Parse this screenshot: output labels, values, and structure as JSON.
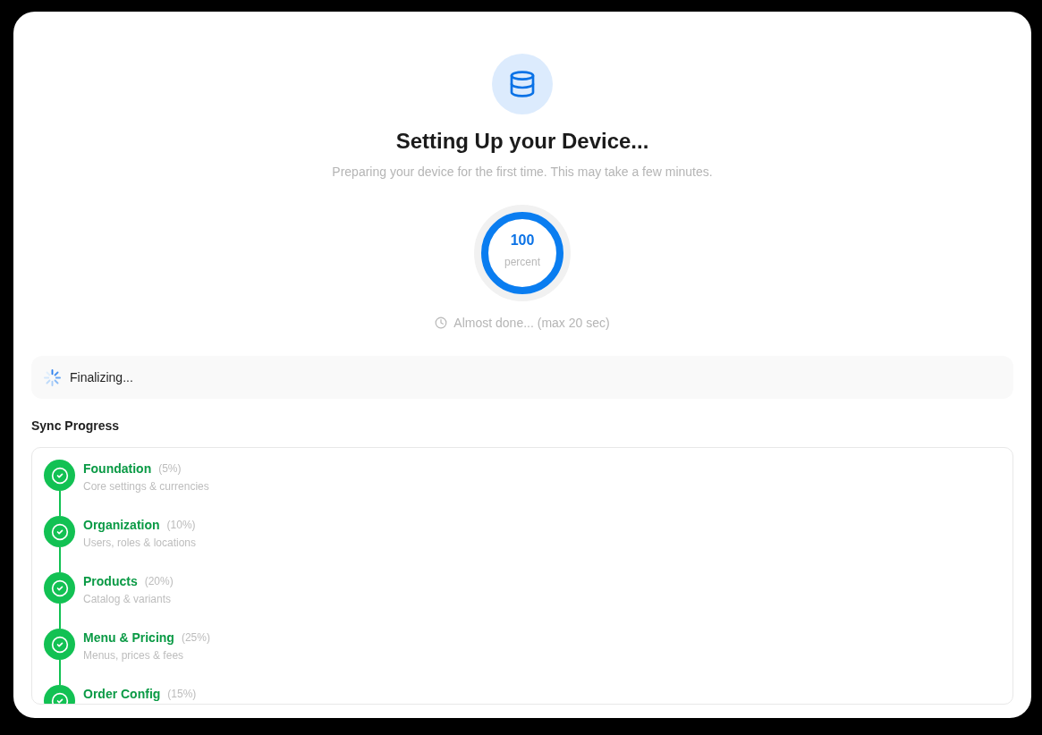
{
  "header": {
    "title": "Setting Up your Device...",
    "subtitle": "Preparing your device for the first time. This may take a few minutes."
  },
  "progress": {
    "level": 1,
    "value": "100",
    "unit": "percent",
    "eta": "Almost done... (max 20 sec)"
  },
  "status_banner": {
    "message": "Finalizing...",
    "busy": true
  },
  "sync_progress": {
    "title": "Sync Progress",
    "steps": [
      {
        "title": "Foundation",
        "share": "(5%)",
        "description": "Core settings & currencies",
        "completed": true
      },
      {
        "title": "Organization",
        "share": "(10%)",
        "description": "Users, roles & locations",
        "completed": true
      },
      {
        "title": "Products",
        "share": "(20%)",
        "description": "Catalog & variants",
        "completed": true
      },
      {
        "title": "Menu & Pricing",
        "share": "(25%)",
        "description": "Menus, prices & fees",
        "completed": true
      },
      {
        "title": "Order Config",
        "share": "(15%)",
        "completed": true
      }
    ]
  }
}
